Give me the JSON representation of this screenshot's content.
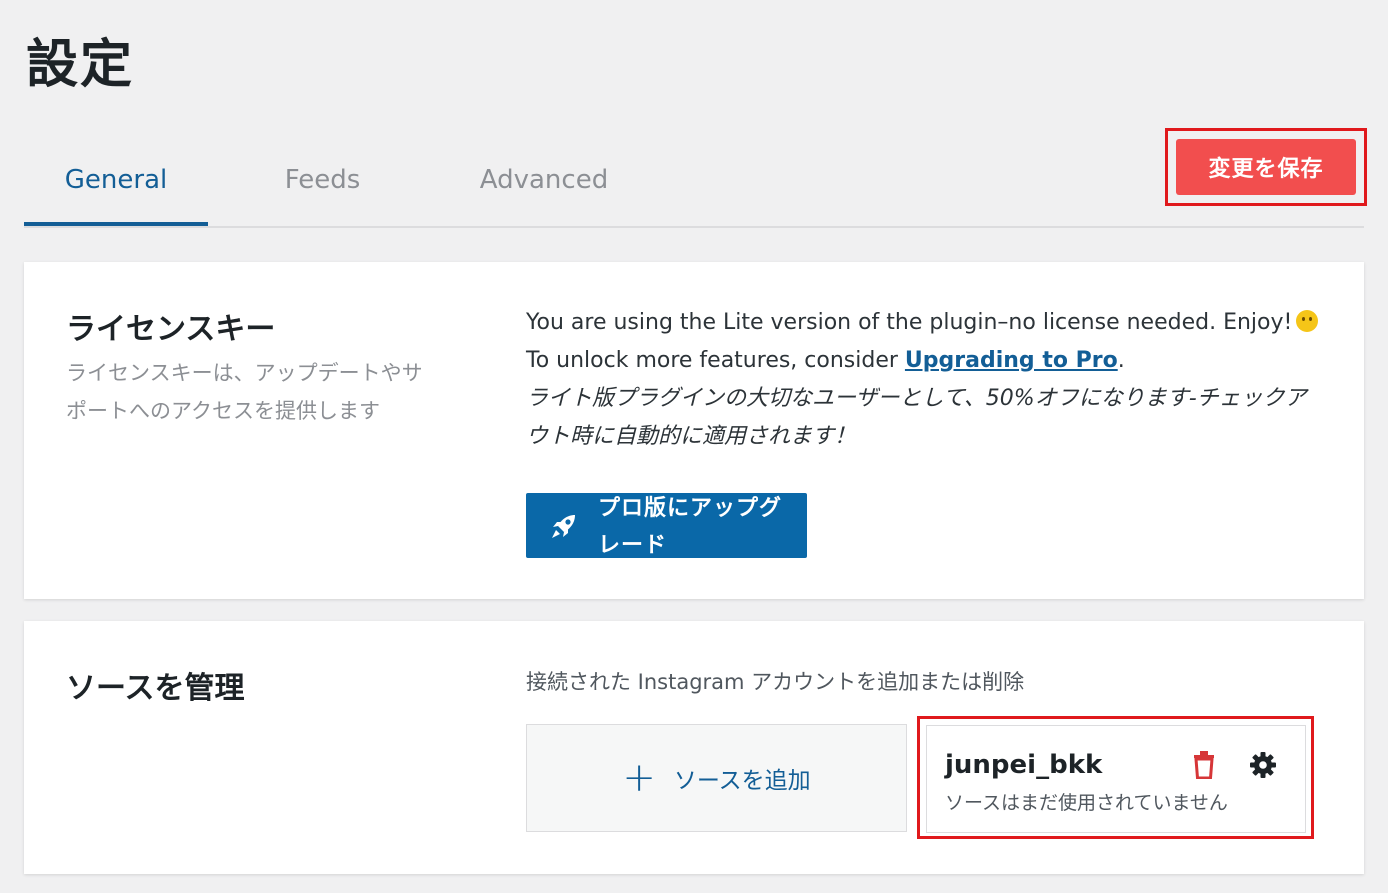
{
  "page": {
    "title": "設定"
  },
  "tabs": [
    {
      "label": "General",
      "active": true
    },
    {
      "label": "Feeds",
      "active": false
    },
    {
      "label": "Advanced",
      "active": false
    }
  ],
  "header": {
    "save_label": "変更を保存"
  },
  "license": {
    "title": "ライセンスキー",
    "description": "ライセンスキーは、アップデートやサポートへのアクセスを提供します",
    "line1": "You are using the Lite version of the plugin–no license needed. Enjoy!",
    "line2_prefix": "To unlock more features, consider ",
    "line2_link": "Upgrading to Pro",
    "line2_suffix": ".",
    "promo": "ライト版プラグインの大切なユーザーとして、50%オフになります-チェックアウト時に自動的に適用されます！",
    "upgrade_button": "プロ版にアップグレード",
    "emoji_icon": "slightly-smiling-face"
  },
  "sources": {
    "title": "ソースを管理",
    "description": "接続された Instagram アカウントを追加または削除",
    "add_label": "ソースを追加",
    "accounts": [
      {
        "name": "junpei_bkk",
        "status": "ソースはまだ使用されていません"
      }
    ]
  },
  "colors": {
    "accent": "#135e96",
    "save_button": "#f24e4e",
    "upgrade_button": "#0a68a8",
    "highlight_border": "#e0191c",
    "background": "#f0f0f1"
  }
}
